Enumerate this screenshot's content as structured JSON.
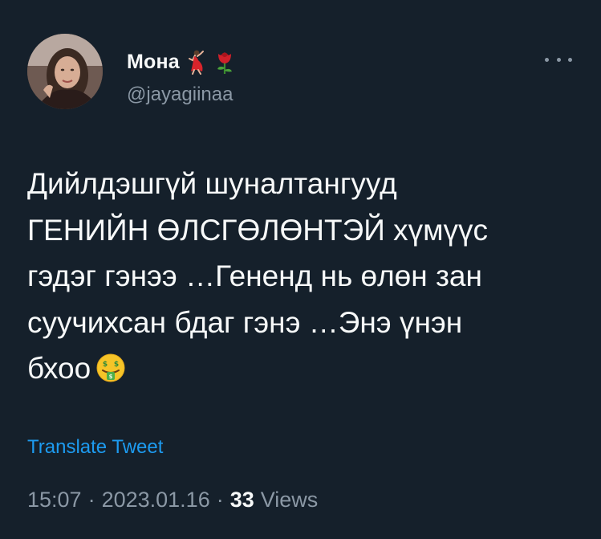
{
  "author": {
    "display_name": "Мона",
    "handle": "@jayagiinaa",
    "name_emojis": [
      "dancer-icon",
      "rose-icon"
    ]
  },
  "tweet": {
    "text": "Дийлдэшгүй шуналтангууд\nГЕНИЙН ӨЛСГӨЛӨНТЭЙ хүмүүс\nгэдэг гэнээ …Гененд нь өлөн зан\nсуучихсан бдаг гэнэ …Энэ үнэн\nбхоо",
    "trailing_emoji": "money-mouth-face-icon"
  },
  "translate_label": "Translate Tweet",
  "meta": {
    "time": "15:07",
    "date": "2023.01.16",
    "separator": "·",
    "views_count": "33",
    "views_label": "Views"
  },
  "colors": {
    "background": "#15202b",
    "text_primary": "#f7f9f9",
    "text_secondary": "#8b98a5",
    "link": "#1d9bf0"
  }
}
